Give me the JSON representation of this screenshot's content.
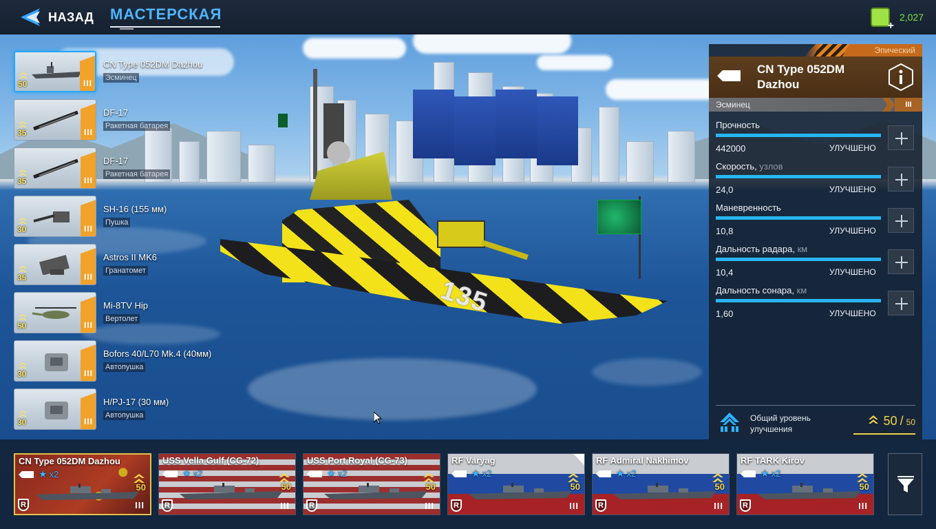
{
  "header": {
    "back_label": "НАЗАД",
    "title": "МАСТЕРСКАЯ",
    "currency_value": "2,027"
  },
  "scene": {
    "hull_number": "135"
  },
  "loadout": [
    {
      "name": "CN Type 052DM Dazhou",
      "type": "Эсминец",
      "level": "50",
      "tier": "III",
      "icon": "destroyer-thumb-icon",
      "selected": true
    },
    {
      "name": "DF-17",
      "type": "Ракетная батарея",
      "level": "35",
      "tier": "III",
      "icon": "missile-thumb-icon"
    },
    {
      "name": "DF-17",
      "type": "Ракетная батарея",
      "level": "35",
      "tier": "III",
      "icon": "missile-thumb-icon"
    },
    {
      "name": "SH-16 (155 мм)",
      "type": "Пушка",
      "level": "30",
      "tier": "III",
      "icon": "cannon-thumb-icon"
    },
    {
      "name": "Astros II MK6",
      "type": "Гранатомет",
      "level": "35",
      "tier": "III",
      "icon": "launcher-thumb-icon"
    },
    {
      "name": "Mi-8TV Hip",
      "type": "Вертолет",
      "level": "50",
      "tier": "III",
      "icon": "helicopter-thumb-icon"
    },
    {
      "name": "Bofors 40/L70 Mk.4 (40мм)",
      "type": "Автопушка",
      "level": "30",
      "tier": "III",
      "icon": "autocannon-thumb-icon"
    },
    {
      "name": "H/PJ-17 (30 мм)",
      "type": "Автопушка",
      "level": "30",
      "tier": "III",
      "icon": "autocannon-thumb-icon"
    }
  ],
  "panel": {
    "rarity": "Эпический",
    "ship_name": "CN Type 052DM Dazhou",
    "class": "Эсминец",
    "tier": "III",
    "stats": [
      {
        "label": "Прочность",
        "unit": "",
        "value": "442000",
        "status": "УЛУЧШЕНО",
        "fill": 1.0
      },
      {
        "label": "Скорость,",
        "unit": " узлов",
        "value": "24,0",
        "status": "УЛУЧШЕНО",
        "fill": 1.0
      },
      {
        "label": "Маневренность",
        "unit": "",
        "value": "10,8",
        "status": "УЛУЧШЕНО",
        "fill": 1.0
      },
      {
        "label": "Дальность радара,",
        "unit": " км",
        "value": "10,4",
        "status": "УЛУЧШЕНО",
        "fill": 1.0
      },
      {
        "label": "Дальность сонара,",
        "unit": " км",
        "value": "1,60",
        "status": "УЛУЧШЕНО",
        "fill": 1.0
      }
    ],
    "overall_label": "Общий уровень улучшения",
    "overall_value": "50",
    "overall_sep": "/",
    "overall_max": "50"
  },
  "fleet": [
    {
      "name": "CN Type 052DM Dazhou",
      "stars": "x2",
      "level": "50",
      "tier": "III",
      "flag": "china",
      "selected": true
    },
    {
      "name": "USS Vella Gulf (CG-72)",
      "stars": "x2",
      "level": "50",
      "tier": "III",
      "flag": "usa"
    },
    {
      "name": "USS Port Royal (CG-73)",
      "stars": "x2",
      "level": "50",
      "tier": "III",
      "flag": "usa"
    },
    {
      "name": "RF Varyag",
      "stars": "x2",
      "level": "50",
      "tier": "III",
      "flag": "russia",
      "corner": true
    },
    {
      "name": "RF Admiral Nakhimov",
      "stars": "x2",
      "level": "50",
      "tier": "III",
      "flag": "russia"
    },
    {
      "name": "RF TARK Kirov",
      "stars": "x2",
      "level": "50",
      "tier": "III",
      "flag": "russia"
    }
  ],
  "fleet_badge": "R",
  "colors": {
    "accent_blue": "#27b6f2",
    "title_blue": "#4fb4ff",
    "gold": "#f3d34a",
    "epic_orange": "#c66a1b",
    "currency_green": "#7fe04a"
  }
}
